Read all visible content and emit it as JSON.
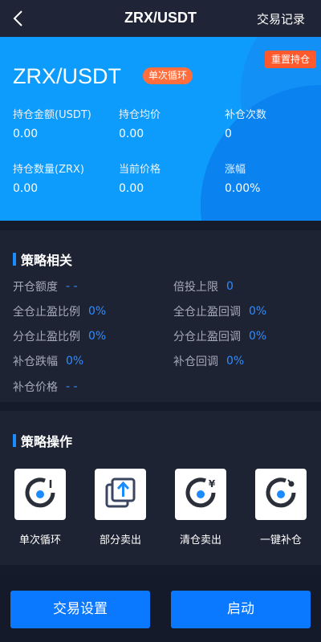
{
  "header": {
    "title": "ZRX/USDT",
    "trade_history_label": "交易记录"
  },
  "hero": {
    "pair": "ZRX/USDT",
    "mode_badge": "单次循环",
    "reset_label": "重置持仓",
    "stats": [
      {
        "label": "持仓金额(USDT)",
        "value": "0.00"
      },
      {
        "label": "持仓均价",
        "value": "0.00"
      },
      {
        "label": "补仓次数",
        "value": "0"
      },
      {
        "label": "持仓数量(ZRX)",
        "value": "0.00"
      },
      {
        "label": "当前价格",
        "value": "0.00"
      },
      {
        "label": "涨幅",
        "value": "0.00%"
      }
    ]
  },
  "strategy": {
    "title": "策略相关",
    "items": [
      {
        "label": "开仓额度",
        "value": "- -"
      },
      {
        "label": "倍投上限",
        "value": "0"
      },
      {
        "label": "全仓止盈比例",
        "value": "0%"
      },
      {
        "label": "全仓止盈回调",
        "value": "0%"
      },
      {
        "label": "分仓止盈比例",
        "value": "0%"
      },
      {
        "label": "分仓止盈回调",
        "value": "0%"
      },
      {
        "label": "补仓跌幅",
        "value": "0%"
      },
      {
        "label": "补仓回调",
        "value": "0%"
      },
      {
        "label": "补仓价格",
        "value": "- -"
      }
    ]
  },
  "operations": {
    "title": "策略操作",
    "items": [
      {
        "label": "单次循环",
        "icon": "single-cycle-icon"
      },
      {
        "label": "部分卖出",
        "icon": "partial-sell-icon"
      },
      {
        "label": "清仓卖出",
        "icon": "clear-sell-icon"
      },
      {
        "label": "一键补仓",
        "icon": "one-click-add-icon"
      }
    ]
  },
  "footer": {
    "settings_label": "交易设置",
    "start_label": "启动"
  },
  "colors": {
    "background": "#151b2b",
    "panel": "#1e2333",
    "hero": "#0d9cfb",
    "accent": "#1b8bff",
    "badge": "#ff6e3c",
    "reset": "#ff5a2e"
  }
}
